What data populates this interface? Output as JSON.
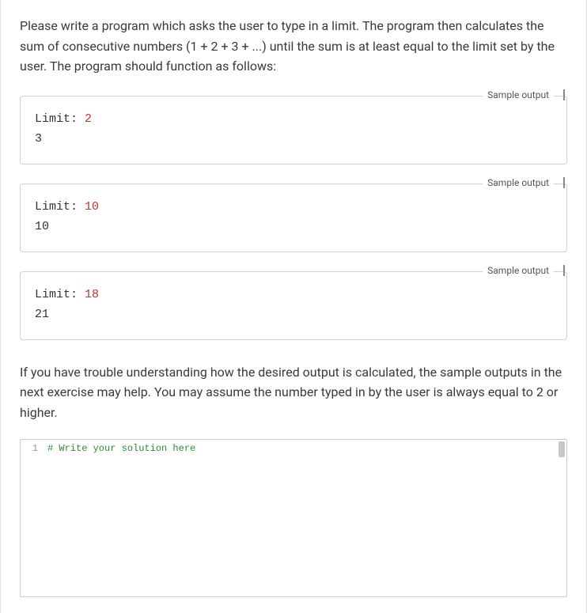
{
  "problem": {
    "paragraph1": "Please write a program which asks the user to type in a limit. The program then calculates the sum of consecutive numbers (1 + 2 + 3 + ...) until the sum is at least equal to the limit set by the user. The program should function as follows:",
    "paragraph2": "If you have trouble understanding how the desired output is calculated, the sample outputs in the next exercise may help. You may assume the number typed in by the user is always equal to 2 or higher."
  },
  "samples": [
    {
      "label": "Sample output",
      "prompt": "Limit: ",
      "input": "2",
      "output": "3"
    },
    {
      "label": "Sample output",
      "prompt": "Limit: ",
      "input": "10",
      "output": "10"
    },
    {
      "label": "Sample output",
      "prompt": "Limit: ",
      "input": "18",
      "output": "21"
    }
  ],
  "editor": {
    "line_number": "1",
    "placeholder_comment": "# Write your solution here"
  }
}
